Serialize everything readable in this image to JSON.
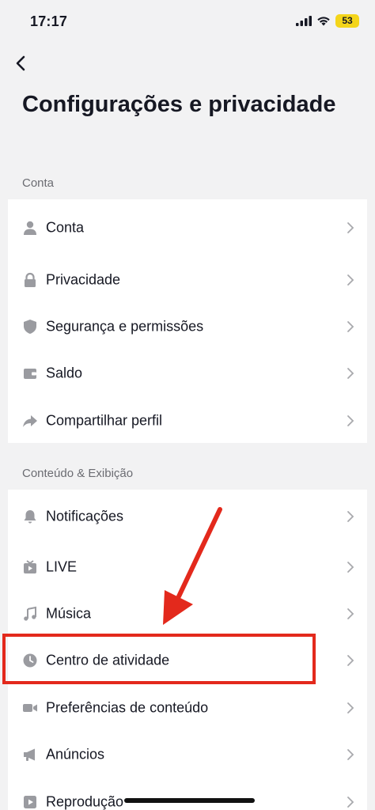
{
  "status_bar": {
    "time": "17:17",
    "battery": "53"
  },
  "title": "Configurações e privacidade",
  "sections": [
    {
      "header": "Conta",
      "items": [
        {
          "label": "Conta",
          "icon": "person-icon"
        },
        {
          "label": "Privacidade",
          "icon": "lock-icon"
        },
        {
          "label": "Segurança e permissões",
          "icon": "shield-icon"
        },
        {
          "label": "Saldo",
          "icon": "wallet-icon"
        },
        {
          "label": "Compartilhar perfil",
          "icon": "share-icon"
        }
      ]
    },
    {
      "header": "Conteúdo & Exibição",
      "items": [
        {
          "label": "Notificações",
          "icon": "bell-icon"
        },
        {
          "label": "LIVE",
          "icon": "tv-icon"
        },
        {
          "label": "Música",
          "icon": "music-note-icon"
        },
        {
          "label": "Centro de atividade",
          "icon": "clock-icon"
        },
        {
          "label": "Preferências de conteúdo",
          "icon": "video-camera-icon"
        },
        {
          "label": "Anúncios",
          "icon": "megaphone-icon"
        },
        {
          "label": "Reprodução",
          "icon": "play-icon"
        }
      ]
    }
  ],
  "annotation_color": "#e3291c"
}
